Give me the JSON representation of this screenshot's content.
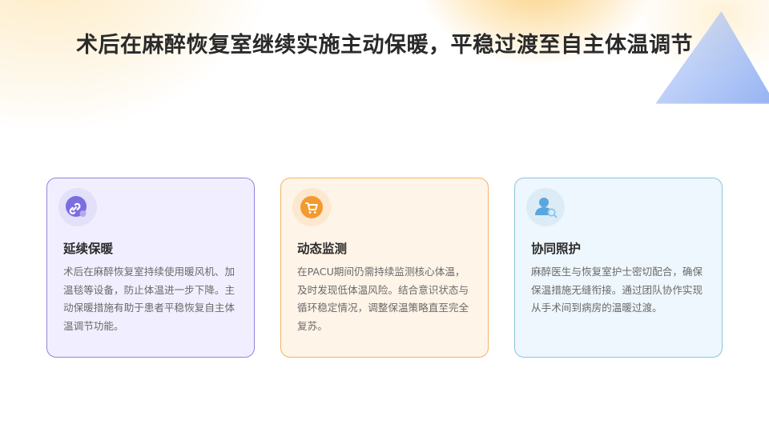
{
  "slide": {
    "title": "术后在麻醉恢复室继续实施主动保暖，平稳过渡至自主体温调节"
  },
  "cards": [
    {
      "title": "延续保暖",
      "body": "术后在麻醉恢复室持续使用暖风机、加温毯等设备，防止体温进一步下降。主动保暖措施有助于患者平稳恢复自主体温调节功能。",
      "icon": "link-app-icon",
      "accent": "#7b6ee0"
    },
    {
      "title": "动态监测",
      "body": "在PACU期间仍需持续监测核心体温，及时发现低体温风险。结合意识状态与循环稳定情况，调整保温策略直至完全复苏。",
      "icon": "shopping-cart-icon",
      "accent": "#f39a2e"
    },
    {
      "title": "协同照护",
      "body": "麻醉医生与恢复室护士密切配合，确保保温措施无缝衔接。通过团队协作实现从手术间到病房的温暖过渡。",
      "icon": "user-search-icon",
      "accent": "#5aa6de"
    }
  ]
}
